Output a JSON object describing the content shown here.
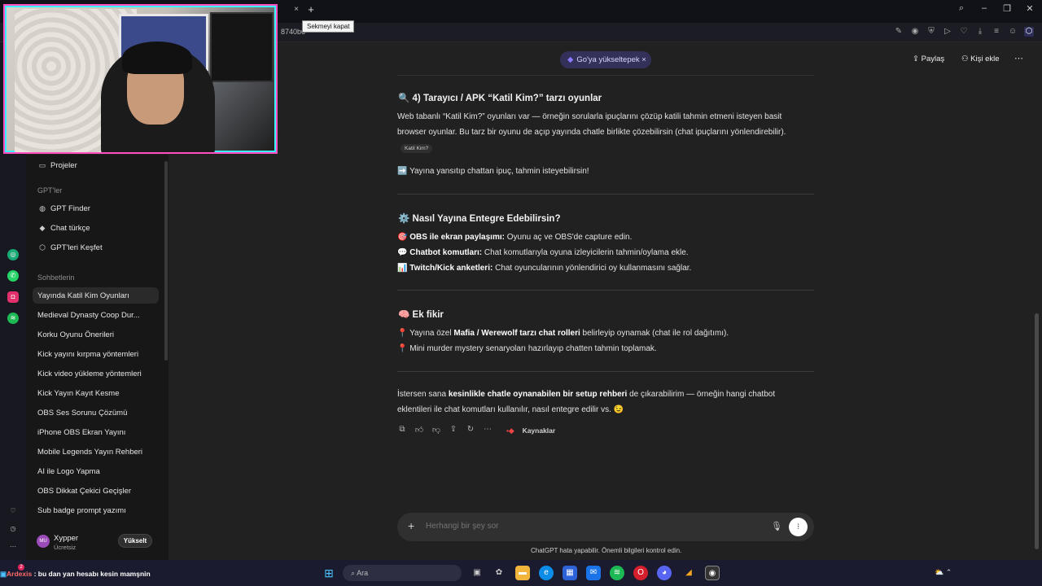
{
  "browser": {
    "tooltip": "Sekmeyi kapat",
    "address_fragment": "8740b6",
    "tab_close_icon": "×",
    "new_tab_icon": "+"
  },
  "header": {
    "upgrade_pill": "Go'ya yükseltерek",
    "share": "Paylaş",
    "add_person": "Kişi ekle"
  },
  "sidebar": {
    "projects": "Projeler",
    "gpts_heading": "GPT'ler",
    "gpts": [
      "GPT Finder",
      "Chat türkçe",
      "GPT'leri Keşfet"
    ],
    "chats_heading": "Sohbetlerin",
    "chats": [
      "Yayında Katil Kim Oyunları",
      "Medieval Dynasty Coop Dur...",
      "Korku Oyunu Önerileri",
      "Kick yayını kırpma yöntemleri",
      "Kick video yükleme yöntemleri",
      "Kick Yayın Kayıt Kesme",
      "OBS Ses Sorunu Çözümü",
      "iPhone OBS Ekran Yayını",
      "Mobile Legends Yayın Rehberi",
      "AI ile Logo Yapma",
      "OBS Dikkat Çekici Geçişler",
      "Sub badge prompt yazımı"
    ],
    "user": {
      "initials": "MU",
      "name": "Xypper",
      "plan": "Ücretsiz",
      "upgrade": "Yükselt"
    }
  },
  "content": {
    "section4_title": "4) Tarayıcı / APK “Katil Kim?” tarzı oyunlar",
    "section4_p1": "Web tabanlı “Katil Kim?” oyunları var — örneğin sorularla ipuçlarını çözüp katili tahmin etmeni isteyen basit",
    "section4_p2": "browser oyunlar. Bu tarz bir oyunu de açıp yayında chatle birlikte çözebilirsin (chat ipuçlarını yönlendirebilir).",
    "section4_chip": "Katil Kim?",
    "section4_arrow": "Yayına yansıtıp chattan ipuç, tahmin isteyebilirsin!",
    "integrate_title": "Nasıl Yayına Entegre Edebilirsin?",
    "integrate_items": [
      {
        "bold": "OBS ile ekran paylaşımı:",
        "text": " Oyunu aç ve OBS'de capture edin."
      },
      {
        "bold": "Chatbot komutları:",
        "text": " Chat komutlarıyla oyuna izleyicilerin tahmin/oylama ekle."
      },
      {
        "bold": "Twitch/Kick anketleri:",
        "text": " Chat oyuncularının yönlendirici oy kullanmasını sağlar."
      }
    ],
    "extra_title": "Ek fikir",
    "extra_line1_pre": "Yayına özel ",
    "extra_line1_bold": "Mafia / Werewolf tarzı chat rolleri",
    "extra_line1_post": " belirleyip oynamak (chat ile rol dağıtımı).",
    "extra_line2": "Mini murder mystery senaryoları hazırlayıp chatten tahmin toplamak.",
    "closing_pre": "İstersen sana ",
    "closing_bold": "kesinlikle chatle oynanabilen bir setup rehberi",
    "closing_post": " de çıkarabilirim — örneğin hangi chatbot",
    "closing_line2": "eklentileri ile chat komutları kullanılır, nasıl entegre edilir vs. 😉",
    "sources": "Kaynaklar"
  },
  "composer": {
    "placeholder": "Herhangi bir şey sor",
    "disclaimer": "ChatGPT hata yapabilir. Önemli bilgileri kontrol edin."
  },
  "taskbar": {
    "overlay_name": "Ardexis",
    "overlay_text": " : bu dan yan hesabı kesin mamşnin",
    "search": "Ara",
    "badge": "2"
  },
  "colors": {
    "pill_bg": "#33305a",
    "webcam_border": "#ff4fbf",
    "accent_cyan": "#3bf0ff"
  }
}
